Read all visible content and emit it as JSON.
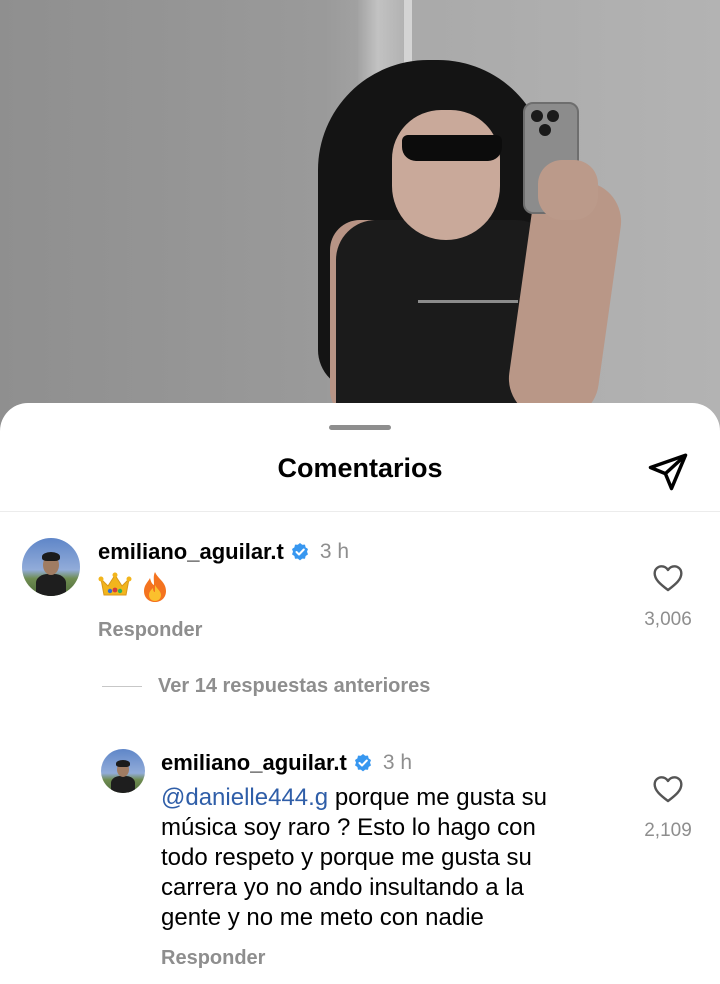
{
  "sheet": {
    "title": "Comentarios"
  },
  "comment": {
    "username": "emiliano_aguilar.t",
    "time": "3 h",
    "emojis": [
      "crown-emoji",
      "fire-emoji"
    ],
    "reply_label": "Responder",
    "like_count": "3,006",
    "view_replies": "Ver 14 respuestas anteriores"
  },
  "reply": {
    "username": "emiliano_aguilar.t",
    "time": "3 h",
    "mention": "@danielle444.g",
    "text_lines": [
      " porque me gusta su",
      "música soy raro ? Esto lo hago con",
      "todo respeto y porque me gusta su",
      "carrera yo no ando insultando a la",
      "gente y no me meto con nadie"
    ],
    "reply_label": "Responder",
    "like_count": "2,109"
  },
  "colors": {
    "verified": "#3797f0",
    "mention": "#2f5ea8",
    "secondary_text": "#8e8e8e"
  },
  "icons": {
    "send": "paper-plane-icon",
    "like": "heart-outline-icon",
    "verified": "verified-badge-icon"
  }
}
